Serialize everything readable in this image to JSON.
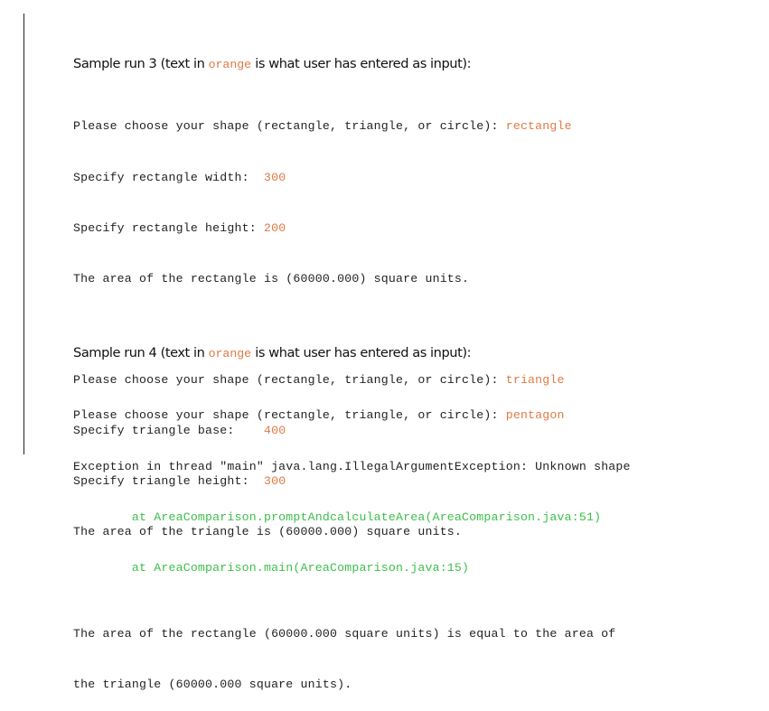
{
  "runs": [
    {
      "heading_prefix": "Sample run 3 (text in ",
      "heading_highlight": "orange",
      "heading_suffix": " is what user has entered as input):",
      "lines": [
        {
          "text": "Please choose your shape (rectangle, triangle, or circle): ",
          "input": "rectangle"
        },
        {
          "text": "Specify rectangle width:  ",
          "input": "300"
        },
        {
          "text": "Specify rectangle height: ",
          "input": "200"
        },
        {
          "text": "The area of the rectangle is (60000.000) square units.",
          "input": ""
        },
        {
          "text": "",
          "input": ""
        },
        {
          "text": "Please choose your shape (rectangle, triangle, or circle): ",
          "input": "triangle"
        },
        {
          "text": "Specify triangle base:    ",
          "input": "400"
        },
        {
          "text": "Specify triangle height:  ",
          "input": "300"
        },
        {
          "text": "The area of the triangle is (60000.000) square units.",
          "input": ""
        },
        {
          "text": "",
          "input": ""
        },
        {
          "text": "The area of the rectangle (60000.000 square units) is equal to the area of",
          "input": ""
        },
        {
          "text": "the triangle (60000.000 square units).",
          "input": ""
        }
      ]
    },
    {
      "heading_prefix": "Sample run 4 (text in ",
      "heading_highlight": "orange",
      "heading_suffix": " is what user has entered as input):",
      "lines": [
        {
          "text": "Please choose your shape (rectangle, triangle, or circle): ",
          "input": "pentagon"
        },
        {
          "text": "Exception in thread \"main\" java.lang.IllegalArgumentException: Unknown shape",
          "input": ""
        }
      ],
      "stack_trace": [
        "        at AreaComparison.promptAndcalculateArea(AreaComparison.java:51)",
        "        at AreaComparison.main(AreaComparison.java:15)"
      ]
    }
  ],
  "colors": {
    "input": "#e07a45",
    "trace": "#3cbf4a",
    "text": "#222222"
  }
}
